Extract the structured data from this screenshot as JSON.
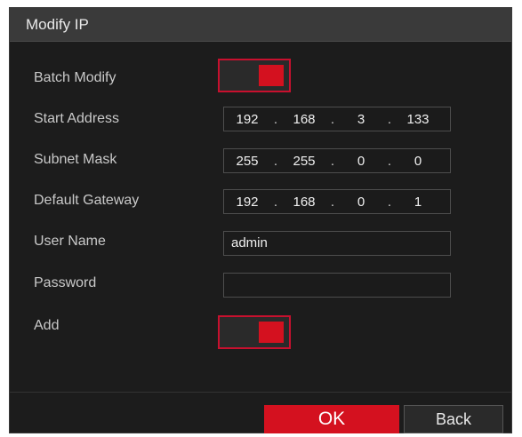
{
  "dialog": {
    "title": "Modify IP",
    "batch_modify": {
      "label": "Batch Modify",
      "on": true
    },
    "start_address": {
      "label": "Start Address",
      "octets": [
        "192",
        "168",
        "3",
        "133"
      ]
    },
    "subnet_mask": {
      "label": "Subnet Mask",
      "octets": [
        "255",
        "255",
        "0",
        "0"
      ]
    },
    "default_gateway": {
      "label": "Default Gateway",
      "octets": [
        "192",
        "168",
        "0",
        "1"
      ]
    },
    "user_name": {
      "label": "User Name",
      "value": "admin"
    },
    "password": {
      "label": "Password",
      "value": ""
    },
    "add": {
      "label": "Add",
      "on": true
    },
    "ok_label": "OK",
    "back_label": "Back"
  },
  "colors": {
    "accent": "#d4111f",
    "panel": "#1c1c1c",
    "titlebar": "#3a3a3a"
  },
  "dot_char": "."
}
